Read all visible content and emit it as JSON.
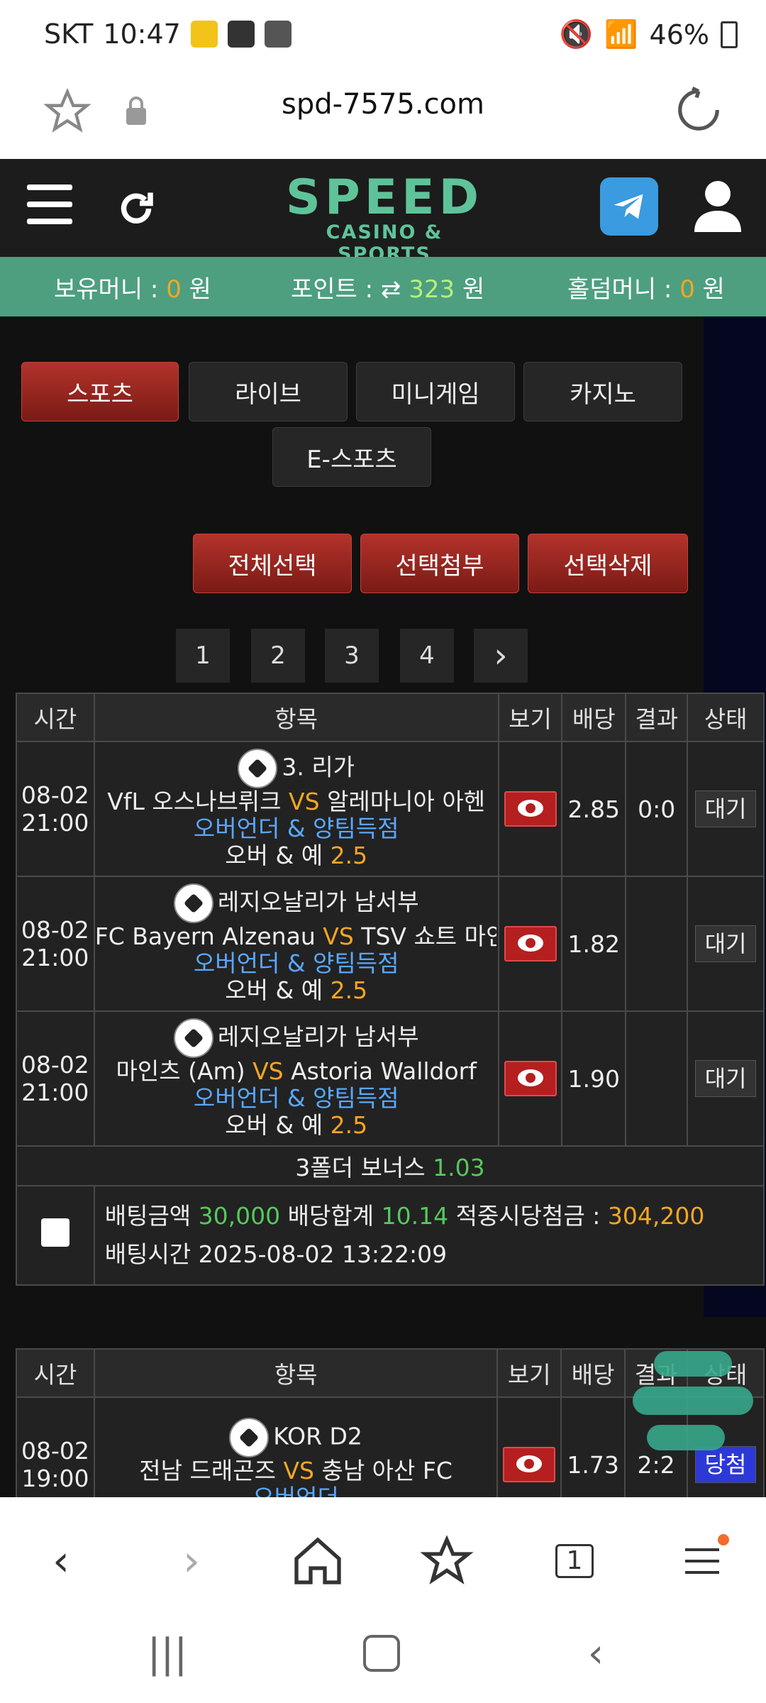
{
  "status_bar": {
    "carrier": "SKT",
    "time": "10:47",
    "battery": "46%"
  },
  "browser": {
    "url": "spd-7575.com"
  },
  "site": {
    "logo_main": "SPEED",
    "logo_sub": "CASINO & SPORTS"
  },
  "money_bar": {
    "balance_label": "보유머니 :",
    "balance_value": "0",
    "balance_unit": "원",
    "points_label": "포인트 :",
    "points_value": "323",
    "points_unit": "원",
    "holdem_label": "홀덤머니 :",
    "holdem_value": "0",
    "holdem_unit": "원"
  },
  "tabs": [
    {
      "label": "스포츠",
      "active": true
    },
    {
      "label": "라이브"
    },
    {
      "label": "미니게임"
    },
    {
      "label": "카지노"
    },
    {
      "label": "E-스포츠"
    }
  ],
  "actions": {
    "select_all": "전체선택",
    "attach": "선택첨부",
    "delete": "선택삭제"
  },
  "pagination": {
    "pages": [
      "1",
      "2",
      "3",
      "4"
    ],
    "next": "›"
  },
  "table_headers": {
    "time": "시간",
    "item": "항목",
    "view": "보기",
    "odds": "배당",
    "result": "결과",
    "status": "상태"
  },
  "bet1": {
    "rows": [
      {
        "date": "08-02",
        "time": "21:00",
        "league": "3. 리가",
        "home": "VfL 오스나브뤼크",
        "vs": "VS",
        "away": "알레마니아 아헨",
        "market": "오버언더 & 양팀득점",
        "pick": "오버 & 예",
        "line": "2.5",
        "odds": "2.85",
        "result": "0:0",
        "status": "대기"
      },
      {
        "date": "08-02",
        "time": "21:00",
        "league": "레지오날리가 남서부",
        "home": "FC Bayern Alzenau",
        "vs": "VS",
        "away": "TSV 쇼트 마인츠",
        "market": "오버언더 & 양팀득점",
        "pick": "오버 & 예",
        "line": "2.5",
        "odds": "1.82",
        "result": "",
        "status": "대기"
      },
      {
        "date": "08-02",
        "time": "21:00",
        "league": "레지오날리가 남서부",
        "home": "마인츠 (Am)",
        "vs": "VS",
        "away": "Astoria Walldorf",
        "market": "오버언더 & 양팀득점",
        "pick": "오버 & 예",
        "line": "2.5",
        "odds": "1.90",
        "result": "",
        "status": "대기"
      }
    ],
    "bonus_label": "3폴더 보너스",
    "bonus_value": "1.03",
    "amount_label": "배팅금액",
    "amount_value": "30,000",
    "total_odds_label": "배당합계",
    "total_odds_value": "10.14",
    "payout_label": "적중시당첨금 :",
    "payout_value": "304,200",
    "bet_time_label": "배팅시간",
    "bet_time_value": "2025-08-02 13:22:09"
  },
  "bet2": {
    "rows": [
      {
        "date": "08-02",
        "time": "19:00",
        "league": "KOR D2",
        "home": "전남 드래곤즈",
        "vs": "VS",
        "away": "충남 아산 FC",
        "market": "오버언더",
        "odds": "1.73",
        "result": "2:2",
        "status": "당첨"
      }
    ]
  },
  "colors": {
    "accent_green": "#4d9f80",
    "red_button": "#b3332b",
    "odds_green": "#55c95c",
    "highlight_orange": "#f5a623",
    "market_blue": "#59a8ff"
  }
}
